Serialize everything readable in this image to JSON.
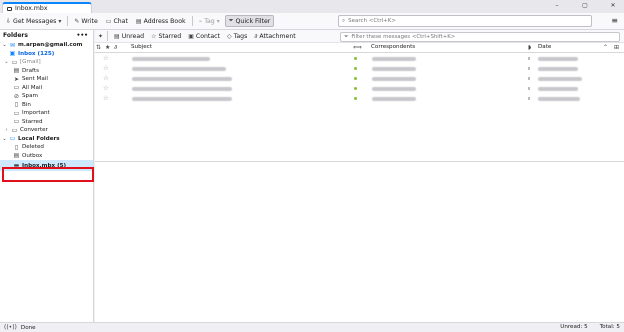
{
  "tab": {
    "title": "Inbox.mbx"
  },
  "window": {
    "minimize": "–",
    "maximize": "▢",
    "close": "✕"
  },
  "toolbar": {
    "get_messages": "Get Messages",
    "write": "Write",
    "chat": "Chat",
    "address_book": "Address Book",
    "tag": "Tag",
    "quick_filter": "Quick Filter",
    "search_placeholder": "Search <Ctrl+K>"
  },
  "sidebar": {
    "header": "Folders",
    "more": "•••",
    "account": "m.arpan@gmail.com",
    "items": [
      {
        "label": "Inbox",
        "count": "(125)"
      },
      {
        "label": "[Gmail]"
      },
      {
        "label": "Drafts"
      },
      {
        "label": "Sent Mail"
      },
      {
        "label": "All Mail"
      },
      {
        "label": "Spam"
      },
      {
        "label": "Bin"
      },
      {
        "label": "Important"
      },
      {
        "label": "Starred"
      },
      {
        "label": "Converter"
      },
      {
        "label": "Local Folders"
      },
      {
        "label": "Deleted"
      },
      {
        "label": "Outbox"
      },
      {
        "label": "Inbox.mbx",
        "count": "(5)"
      }
    ]
  },
  "quickfilter": {
    "unread": "Unread",
    "starred": "Starred",
    "contact": "Contact",
    "tags": "Tags",
    "attachment": "Attachment",
    "filter_placeholder": "Filter these messages <Ctrl+Shift+K>"
  },
  "columns": {
    "subject": "Subject",
    "correspondents": "Correspondents",
    "date": "Date"
  },
  "status": {
    "done": "Done",
    "unread": "Unread: 5",
    "total": "Total: 5"
  },
  "colors": {
    "accent": "#0a84ff",
    "selected": "#cde8ff",
    "highlight": "#e0101a",
    "unread_dot": "#84c43c"
  },
  "icons": [
    "envelope-icon",
    "pencil-icon",
    "chat-icon",
    "address-book-icon",
    "tag-icon",
    "filter-icon",
    "search-icon",
    "menu-icon",
    "pin-icon",
    "star-icon",
    "contact-icon",
    "attachment-icon"
  ]
}
